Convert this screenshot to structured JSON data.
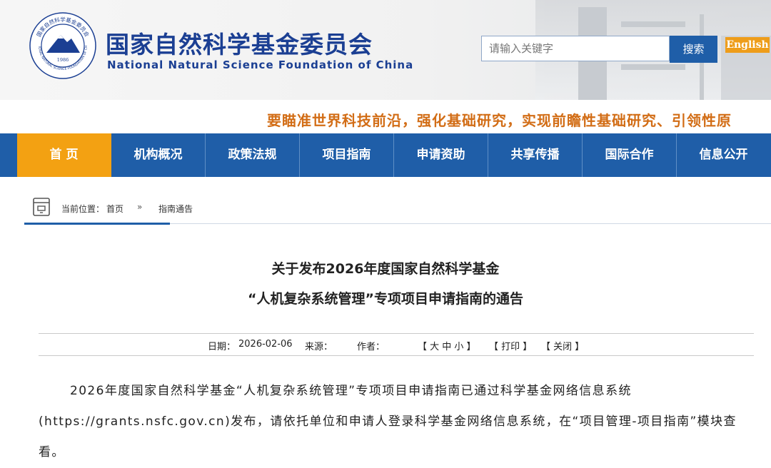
{
  "header": {
    "title_cn": "国家自然科学基金委员会",
    "title_en": "National Natural Science Foundation of China",
    "logo": {
      "year": "1986",
      "ring_text": "NATIONAL NATURAL SCIENCE FOUNDATION OF CHINA",
      "ring_text_cn": "国家自然科学基金委员会"
    }
  },
  "search": {
    "placeholder": "请输入关键字",
    "button_label": "搜索"
  },
  "language_link": "English",
  "slogan": "要瞄准世界科技前沿，强化基础研究，实现前瞻性基础研究、引领性原",
  "nav": {
    "items": [
      "首 页",
      "机构概况",
      "政策法规",
      "项目指南",
      "申请资助",
      "共享传播",
      "国际合作",
      "信息公开"
    ],
    "active_index": 0
  },
  "breadcrumb": {
    "label": "当前位置：",
    "home": "首页",
    "separator": "»",
    "current": "指南通告"
  },
  "article": {
    "title_line1": "关于发布2026年度国家自然科学基金",
    "title_line2": "“人机复杂系统管理”专项项目申请指南的通告",
    "date_label": "日期：",
    "date": "2026-02-06",
    "source_label": "来源：",
    "source": "",
    "author_label": "作者：",
    "author": "",
    "font_size_control": "【 大 中 小 】",
    "print_label": "【 打印 】",
    "close_label": "【 关闭 】",
    "body": "2026年度国家自然科学基金“人机复杂系统管理”专项项目申请指南已通过科学基金网络信息系统(https://grants.nsfc.gov.cn)发布，请依托单位和申请人登录科学基金网络信息系统，在“项目管理-项目指南”模块查看。"
  },
  "colors": {
    "primary_blue": "#1f5ea8",
    "active_orange": "#f3a112",
    "slogan_orange": "#d26d16",
    "english_badge": "#ee9d1a"
  }
}
